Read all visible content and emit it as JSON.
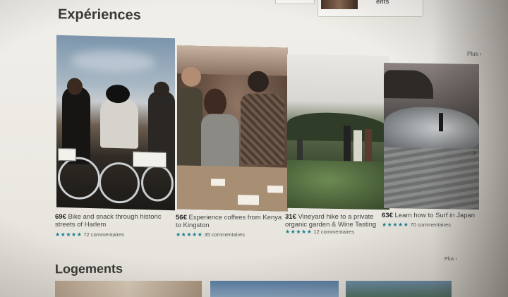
{
  "header": {
    "top_card_text": "ents"
  },
  "sections": {
    "experiences": {
      "title": "Expériences",
      "more_label": "Plus"
    },
    "logements": {
      "title": "Logements",
      "more_label": "Plus"
    }
  },
  "experiences": [
    {
      "price": "69€",
      "title": "Bike and snack through historic streets of Harlem",
      "stars": "★★★★★",
      "reviews": "72 commentaires"
    },
    {
      "price": "56€",
      "title": "Experience coffees from Kenya to Kingston",
      "stars": "★★★★★",
      "reviews": "35 commentaires"
    },
    {
      "price": "31€",
      "title": "Vineyard hike to a private organic garden & Wine Tasting",
      "stars": "★★★★★",
      "reviews": "12 commentaires"
    },
    {
      "price": "63€",
      "title": "Learn how to Surf in Japan",
      "stars": "★★★★★",
      "reviews": "70 commentaires"
    }
  ],
  "icons": {
    "next": "chevron-right-icon",
    "more": "chevron-right-icon"
  },
  "colors": {
    "star": "#157f8c",
    "text": "#3a3836"
  }
}
